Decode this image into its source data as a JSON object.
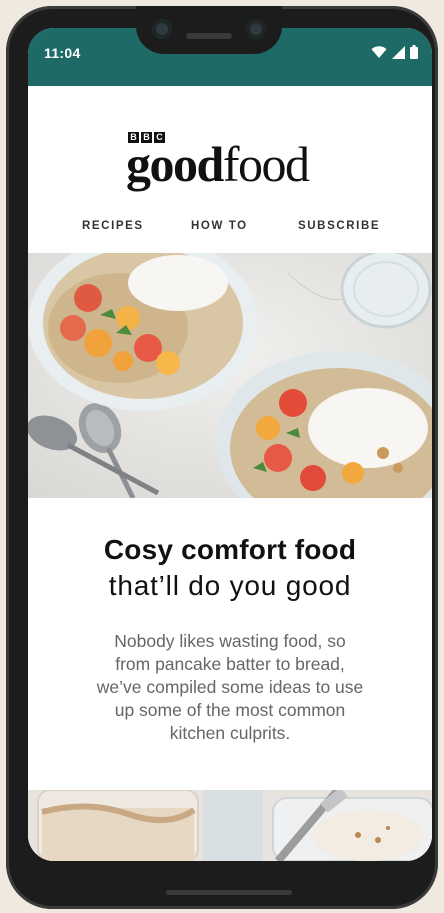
{
  "status_bar": {
    "time": "11:04",
    "icons": [
      "wifi-icon",
      "signal-icon",
      "battery-icon"
    ],
    "background_color": "#1d6a66"
  },
  "logo": {
    "bbc_letters": [
      "B",
      "B",
      "C"
    ],
    "word_bold": "good",
    "word_regular": "food"
  },
  "nav": {
    "items": [
      {
        "label": "RECIPES"
      },
      {
        "label": "HOW TO"
      },
      {
        "label": "SUBSCRIBE"
      }
    ]
  },
  "hero": {
    "image": "porridge-bowls-with-fruit-photo"
  },
  "article": {
    "headline": "Cosy comfort food",
    "subhead": "that’ll do you good",
    "body_lines": [
      "Nobody likes wasting food, so",
      "from pancake batter to bread,",
      "we’ve compiled some ideas to use",
      "up some of the most common",
      "kitchen culprits."
    ]
  },
  "bottom_image": {
    "image": "jars-dessert-photo"
  }
}
